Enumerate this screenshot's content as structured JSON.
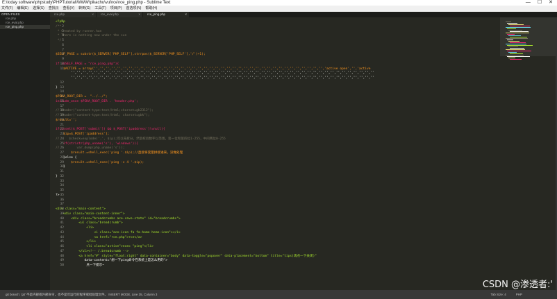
{
  "window": {
    "title": "E:\\Ioday software\\phpstudy\\PHPTutorial\\WWW\\pikachu\\vul\\rce\\rce_ping.php - Sublime Text",
    "controls": [
      "—",
      "☐",
      "✕"
    ]
  },
  "menu": [
    "文件(F)",
    "编辑(E)",
    "选择(S)",
    "查找(I)",
    "查看(V)",
    "转到(G)",
    "工具(T)",
    "项目(P)",
    "首选项(N)",
    "帮助(H)"
  ],
  "sidebar": {
    "header": "OPEN FILES",
    "files": [
      {
        "label": "rce.php",
        "active": false
      },
      {
        "label": "rce_eval.php",
        "active": false
      },
      {
        "label": "rce_ping.php",
        "active": true
      }
    ]
  },
  "tabs": [
    {
      "label": "rce.php",
      "active": false
    },
    {
      "label": "rce_eval.php",
      "active": false
    },
    {
      "label": "rce_ping.php",
      "active": true
    }
  ],
  "editor": {
    "lines": [
      {
        "n": "1",
        "text": "<?php"
      },
      {
        "n": "2",
        "text": "/**"
      },
      {
        "n": "3",
        "text": " * Created by runner.han"
      },
      {
        "n": "4",
        "text": " * There is nothing new under the sun"
      },
      {
        "n": "5",
        "text": " */"
      },
      {
        "n": "6",
        "text": ""
      },
      {
        "n": "7",
        "text": ""
      },
      {
        "n": "8",
        "text": "$SELF_PAGE = substr($_SERVER['PHP_SELF'],strrpos($_SERVER['PHP_SELF'],'/')+1);"
      },
      {
        "n": "9",
        "text": ""
      },
      {
        "n": "10",
        "text": "if ($SELF_PAGE = \"rce_ping.php\"){"
      },
      {
        "n": "11",
        "text": "    $ACTIVE = array('','','','','','','','','','','','','','','','','','','','','','','','','','','','','','','','','','','','','','','','','active open','','active"
      },
      {
        "n": "",
        "text": "        '','','','','','','','','','','','','','','','','','','','','','','','','','','','','','','','','','','','','','','','','','','','','','','','','','','','',''"
      },
      {
        "n": "",
        "text": "        '','','','','','','','','','','','','','','','','','','','','','','','','','','','','','','','','','','','','','','','','','','','','','','','','','','','',''"
      },
      {
        "n": "12",
        "text": ""
      },
      {
        "n": "13",
        "text": "}"
      },
      {
        "n": "14",
        "text": ""
      },
      {
        "n": "15",
        "text": "$PIKA_ROOT_DIR =  \"../../\";"
      },
      {
        "n": "16",
        "text": "include_once $PIKA_ROOT_DIR . 'header.php';"
      },
      {
        "n": "17",
        "text": ""
      },
      {
        "n": "18",
        "text": "// header(\"content-type:text/html;charset=gb2312\");"
      },
      {
        "n": "19",
        "text": "// header(\"content-type:text/html; charset=gbk\");"
      },
      {
        "n": "20",
        "text": "$result='';"
      },
      {
        "n": "21",
        "text": ""
      },
      {
        "n": "22",
        "text": "if(isset($_POST['submit']) && $_POST['ipaddress']!=null){"
      },
      {
        "n": "23",
        "text": "    $ip=$_POST['ipaddress'];"
      },
      {
        "n": "24",
        "text": "//     $check=explode('.', $ip);可以先拆分，然后校验数字以范围，第一位和第四位1-255，中间两位0-255"
      },
      {
        "n": "25",
        "text": "    if(stristr(php_uname('s'), 'windows')){"
      },
      {
        "n": "26",
        "text": "//         var_dump(php_uname('s'));"
      },
      {
        "n": "27",
        "text": "        $result.=shell_exec('ping '.$ip);//直接将变量拼接进来，没做处理"
      },
      {
        "n": "28",
        "text": "    }else {"
      },
      {
        "n": "29",
        "text": "        $result.=shell_exec('ping -c 4 '.$ip);"
      },
      {
        "n": "30",
        "text": "    }"
      },
      {
        "n": "31",
        "text": ""
      },
      {
        "n": "32",
        "text": "}"
      },
      {
        "n": "33",
        "text": ""
      },
      {
        "n": "34",
        "text": ""
      },
      {
        "n": "35",
        "text": ""
      },
      {
        "n": "35",
        "text": "?>"
      },
      {
        "n": "36",
        "text": ""
      },
      {
        "n": "37",
        "text": ""
      },
      {
        "n": "38",
        "text": "<div class=\"main-content\">"
      },
      {
        "n": "39",
        "text": "    <div class=\"main-content-inner\">"
      },
      {
        "n": "40",
        "text": "        <div class=\"breadcrumbs ace-save-state\" id=\"breadcrumbs\">"
      },
      {
        "n": "41",
        "text": "            <ul class=\"breadcrumb\">"
      },
      {
        "n": "42",
        "text": "                <li>"
      },
      {
        "n": "43",
        "text": "                    <i class=\"ace-icon fa fa-home home-icon\"></i>"
      },
      {
        "n": "44",
        "text": "                    <a href=\"rce.php\">rce</a>"
      },
      {
        "n": "45",
        "text": "                </li>"
      },
      {
        "n": "46",
        "text": "                <li class=\"active\">exec \"ping\"</li>"
      },
      {
        "n": "47",
        "text": "            </ul><!-- /.breadcrumb -->"
      },
      {
        "n": "48",
        "text": "            <a href=\"#\" style=\"float:right\" data-container=\"body\" data-toggle=\"popover\" data-placement=\"bottom\" title=\"tips(再点一下关闭)\""
      },
      {
        "n": "49",
        "text": "               data-content=\"想一下ping命令在系统上是怎么用的\">"
      },
      {
        "n": "50",
        "text": "                点一下提示~"
      }
    ]
  },
  "status": {
    "left": "git branch: 'git' 不是内部或外部命令，也不是可运行的程序或批处理文件。 INSERT MODE, Line 35, Column 3",
    "tab_size": "Tab Size: 4",
    "syntax": "PHP"
  },
  "watermark": "CSDN @渗透者:'",
  "colors": {
    "background": "#272822",
    "keyword": "#f92672",
    "string": "#e6db74",
    "comment": "#75715e",
    "function": "#66d9ef",
    "variable": "#fd971f"
  }
}
